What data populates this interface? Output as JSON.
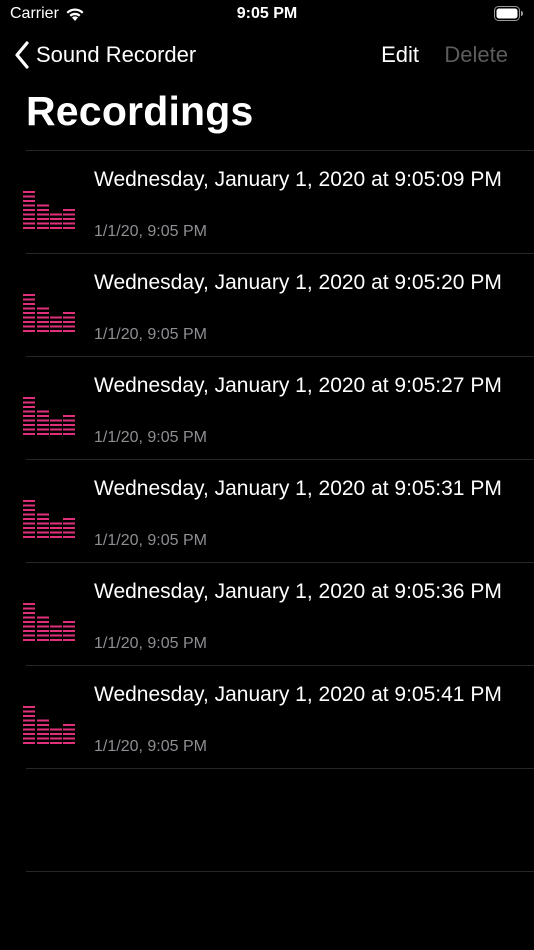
{
  "status_bar": {
    "carrier": "Carrier",
    "time": "9:05 PM"
  },
  "nav": {
    "back_label": "Sound Recorder",
    "edit_label": "Edit",
    "delete_label": "Delete"
  },
  "title": "Recordings",
  "colors": {
    "accent": "#e0307a",
    "background": "#000000",
    "secondary_text": "#8e8e93",
    "disabled_text": "#5c5c5c"
  },
  "recordings": [
    {
      "title": "Wednesday, January 1, 2020 at 9:05:09 PM",
      "subtitle": "1/1/20, 9:05 PM",
      "icon": "waveform-icon"
    },
    {
      "title": "Wednesday, January 1, 2020 at 9:05:20 PM",
      "subtitle": "1/1/20, 9:05 PM",
      "icon": "waveform-icon"
    },
    {
      "title": "Wednesday, January 1, 2020 at 9:05:27 PM",
      "subtitle": "1/1/20, 9:05 PM",
      "icon": "waveform-icon"
    },
    {
      "title": "Wednesday, January 1, 2020 at 9:05:31 PM",
      "subtitle": "1/1/20, 9:05 PM",
      "icon": "waveform-icon"
    },
    {
      "title": "Wednesday, January 1, 2020 at 9:05:36 PM",
      "subtitle": "1/1/20, 9:05 PM",
      "icon": "waveform-icon"
    },
    {
      "title": "Wednesday, January 1, 2020 at 9:05:41 PM",
      "subtitle": "1/1/20, 9:05 PM",
      "icon": "waveform-icon"
    }
  ]
}
